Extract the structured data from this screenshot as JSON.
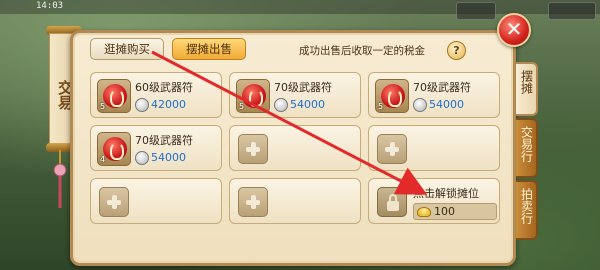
{
  "status_bar": {
    "time": "14:03"
  },
  "window": {
    "title": "交易",
    "close_label": "✕"
  },
  "tabs": {
    "buy_label": "逛摊购买",
    "sell_label": "摆摊出售"
  },
  "tax_note": "成功出售后收取一定的税金",
  "help_label": "?",
  "slots": [
    {
      "name": "60级武器符",
      "price": "42000",
      "qty": "5"
    },
    {
      "name": "70级武器符",
      "price": "54000",
      "qty": "5"
    },
    {
      "name": "70级武器符",
      "price": "54000",
      "qty": "5"
    },
    {
      "name": "70级武器符",
      "price": "54000",
      "qty": "4"
    }
  ],
  "locked_slot": {
    "label": "点击解锁摊位",
    "cost": "100"
  },
  "side_tabs": [
    {
      "label": "摆摊",
      "active": true
    },
    {
      "label": "交易行",
      "active": false
    },
    {
      "label": "拍卖行",
      "active": false
    }
  ],
  "colors": {
    "price": "#1f6fd1",
    "sell_tab": "#f0aa35",
    "close": "#d3221d",
    "annotation_arrow": "#e22a2a"
  },
  "icons": {
    "item": "red-talisman-icon",
    "currency": "silver-coin-icon",
    "unlock_currency": "gold-ingot-icon",
    "empty_slot": "plus-icon",
    "locked": "lock-icon"
  }
}
